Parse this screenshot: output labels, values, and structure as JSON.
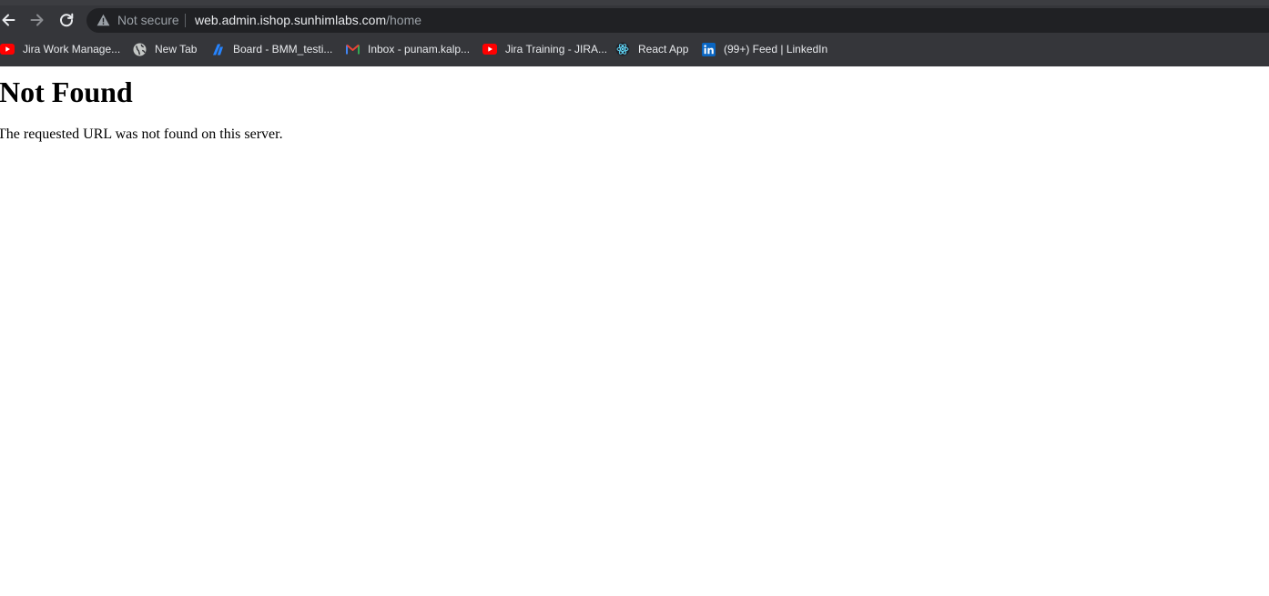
{
  "browser": {
    "security_label": "Not secure",
    "url_host": "web.admin.ishop.sunhimlabs.com",
    "url_path": "/home"
  },
  "bookmarks": [
    {
      "label": "Jira Work Manage...",
      "icon": "youtube-icon",
      "icon_color": "#ff0000"
    },
    {
      "label": "New Tab",
      "icon": "globe-icon",
      "icon_color": "#c4c7c5"
    },
    {
      "label": "Board - BMM_testi...",
      "icon": "jira-icon",
      "icon_color": "#2684ff"
    },
    {
      "label": "Inbox - punam.kalp...",
      "icon": "gmail-icon",
      "icon_color": "#ea4335"
    },
    {
      "label": "Jira Training - JIRA...",
      "icon": "youtube-icon",
      "icon_color": "#ff0000"
    },
    {
      "label": "React App",
      "icon": "react-icon",
      "icon_color": "#61dafb"
    },
    {
      "label": "(99+) Feed | LinkedIn",
      "icon": "linkedin-icon",
      "icon_color": "#0a66c2"
    }
  ],
  "page": {
    "heading": "Not Found",
    "message": "The requested URL was not found on this server."
  }
}
